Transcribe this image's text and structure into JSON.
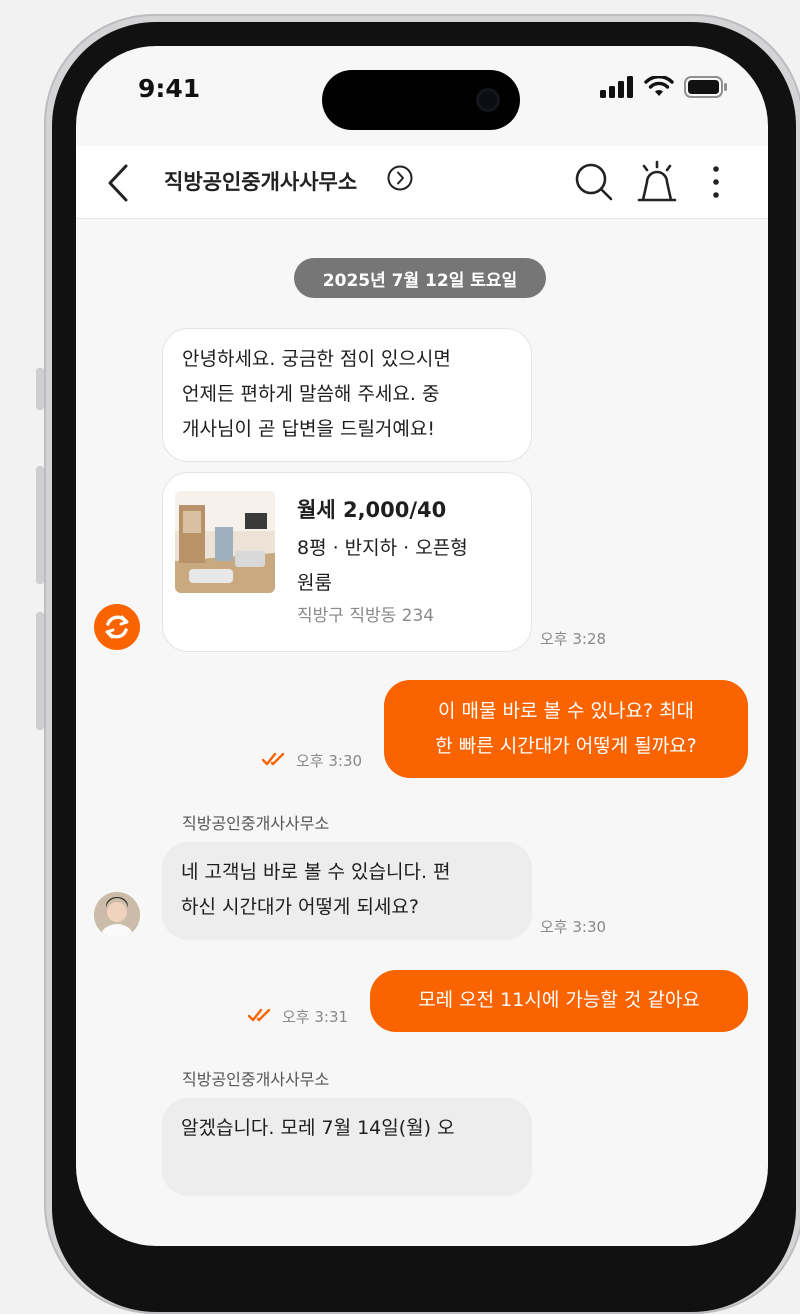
{
  "status_bar": {
    "time": "9:41"
  },
  "header": {
    "title": "직방공인중개사사무소"
  },
  "chat": {
    "date_divider": "2025년 7월 12일 토요일",
    "messages": [
      {
        "id": "m1",
        "direction": "incoming",
        "lines": [
          "안녕하세요. 궁금한 점이 있으시면",
          "언제든 편하게 말씀해 주세요. 중",
          "개사님이 곧 답변을 드릴거예요!"
        ]
      },
      {
        "id": "m2",
        "direction": "incoming",
        "type": "listing-card",
        "listing": {
          "price": "월세 2,000/40",
          "desc_lines": [
            "8평 · 반지하 · 오픈형",
            "원룸"
          ],
          "address": "직방구 직방동 234"
        },
        "time": "오후 3:28"
      },
      {
        "id": "m3",
        "direction": "outgoing",
        "lines": [
          "이 매물 바로 볼 수 있나요? 최대",
          "한 빠른 시간대가 어떻게 될까요?"
        ],
        "time": "오후 3:30",
        "read": true
      },
      {
        "id": "m4",
        "direction": "incoming",
        "sender": "직방공인중개사사무소",
        "lines": [
          "네 고객님 바로 볼 수 있습니다. 편",
          "하신 시간대가 어떻게 되세요?"
        ],
        "time": "오후 3:30"
      },
      {
        "id": "m5",
        "direction": "outgoing",
        "lines": [
          "모레 오전 11시에 가능할 것 같아요"
        ],
        "time": "오후 3:31",
        "read": true
      },
      {
        "id": "m6",
        "direction": "incoming",
        "sender": "직방공인중개사사무소",
        "lines": [
          "알겠습니다. 모레 7월 14일(월) 오"
        ]
      }
    ]
  },
  "colors": {
    "accent": "#fa6400",
    "date_pill": "#767676",
    "bubble_gray": "#ededed"
  },
  "icons": {
    "back": "chevron-left-icon",
    "title_chevron": "chevron-right-circle-icon",
    "search": "search-icon",
    "alarm": "siren-icon",
    "more": "more-vertical-icon",
    "read_mark": "double-check-icon",
    "agency_avatar": "zigbang-logo-icon"
  }
}
